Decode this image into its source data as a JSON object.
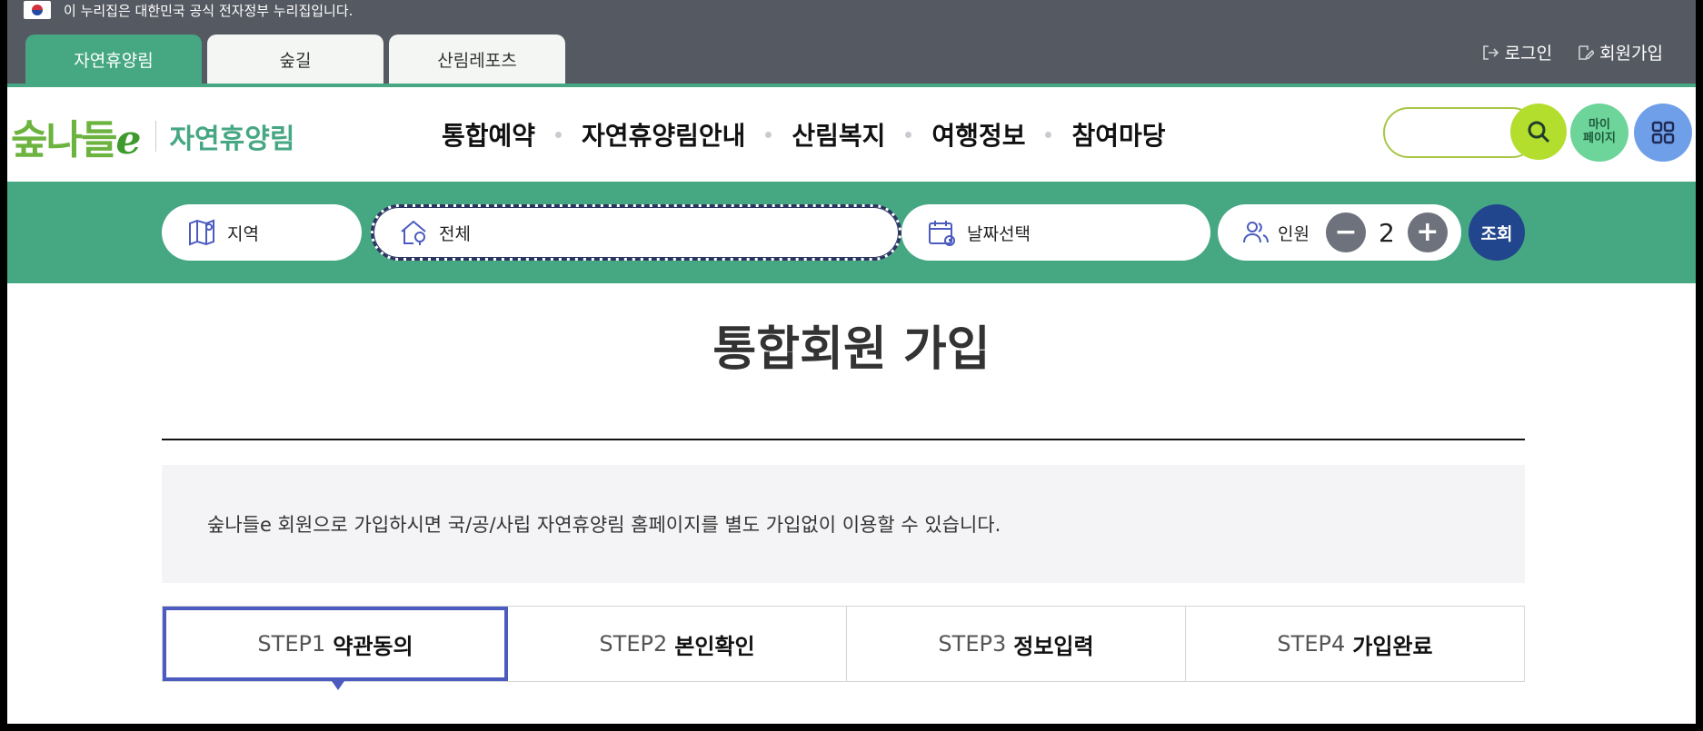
{
  "gov_banner": {
    "text": "이 누리집은 대한민국 공식 전자정부 누리집입니다."
  },
  "site_tabs": [
    {
      "label": "자연휴양림",
      "active": true
    },
    {
      "label": "숲길",
      "active": false
    },
    {
      "label": "산림레포츠",
      "active": false
    }
  ],
  "util_links": {
    "login": "로그인",
    "signup": "회원가입"
  },
  "logo": {
    "main": "숲나들",
    "e": "e",
    "sub": "자연휴양림"
  },
  "gnb": [
    "통합예약",
    "자연휴양림안내",
    "산림복지",
    "여행정보",
    "참여마당"
  ],
  "search": {
    "placeholder": ""
  },
  "my_page": {
    "line1": "마이",
    "line2": "페이지"
  },
  "reservation": {
    "region": "지역",
    "place": "전체",
    "date": "날짜선택",
    "people_label": "인원",
    "people_count": "2",
    "minus": "−",
    "plus": "+",
    "search_label": "조회"
  },
  "page_title": "통합회원 가입",
  "notice_text": "숲나들e 회원으로 가입하시면 국/공/사립 자연휴양림 홈페이지를 별도 가입없이 이용할 수 있습니다.",
  "steps": [
    {
      "num": "STEP1",
      "label": "약관동의",
      "active": true
    },
    {
      "num": "STEP2",
      "label": "본인확인",
      "active": false
    },
    {
      "num": "STEP3",
      "label": "정보입력",
      "active": false
    },
    {
      "num": "STEP4",
      "label": "가입완료",
      "active": false
    }
  ],
  "colors": {
    "brand_green": "#46a783",
    "search_lime": "#b4de2e",
    "navy": "#21468d",
    "step_active": "#4b5bbf"
  }
}
